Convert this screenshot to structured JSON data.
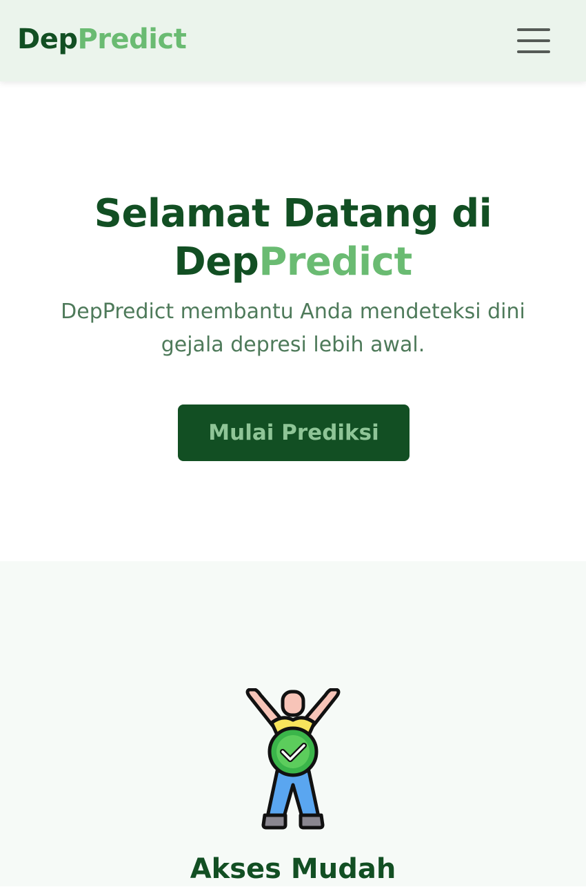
{
  "navbar": {
    "brand_part1": "Dep",
    "brand_part2": "Predict",
    "menu_icon": "hamburger-menu-icon"
  },
  "hero": {
    "title_line1": "Selamat Datang di",
    "title_line2_part1": "Dep",
    "title_line2_part2": "Predict",
    "description": "DepPredict membantu Anda mendeteksi dini gejala depresi lebih awal.",
    "cta_label": "Mulai Prediksi"
  },
  "features": {
    "items": [
      {
        "icon": "person-checkmark-icon",
        "title": "Akses Mudah"
      }
    ]
  },
  "colors": {
    "brand_dark": "#124f23",
    "brand_light": "#6abb72",
    "navbar_bg": "#ebf4ec",
    "text_muted": "#4e7a5a",
    "section_bg": "#f6faf7"
  }
}
